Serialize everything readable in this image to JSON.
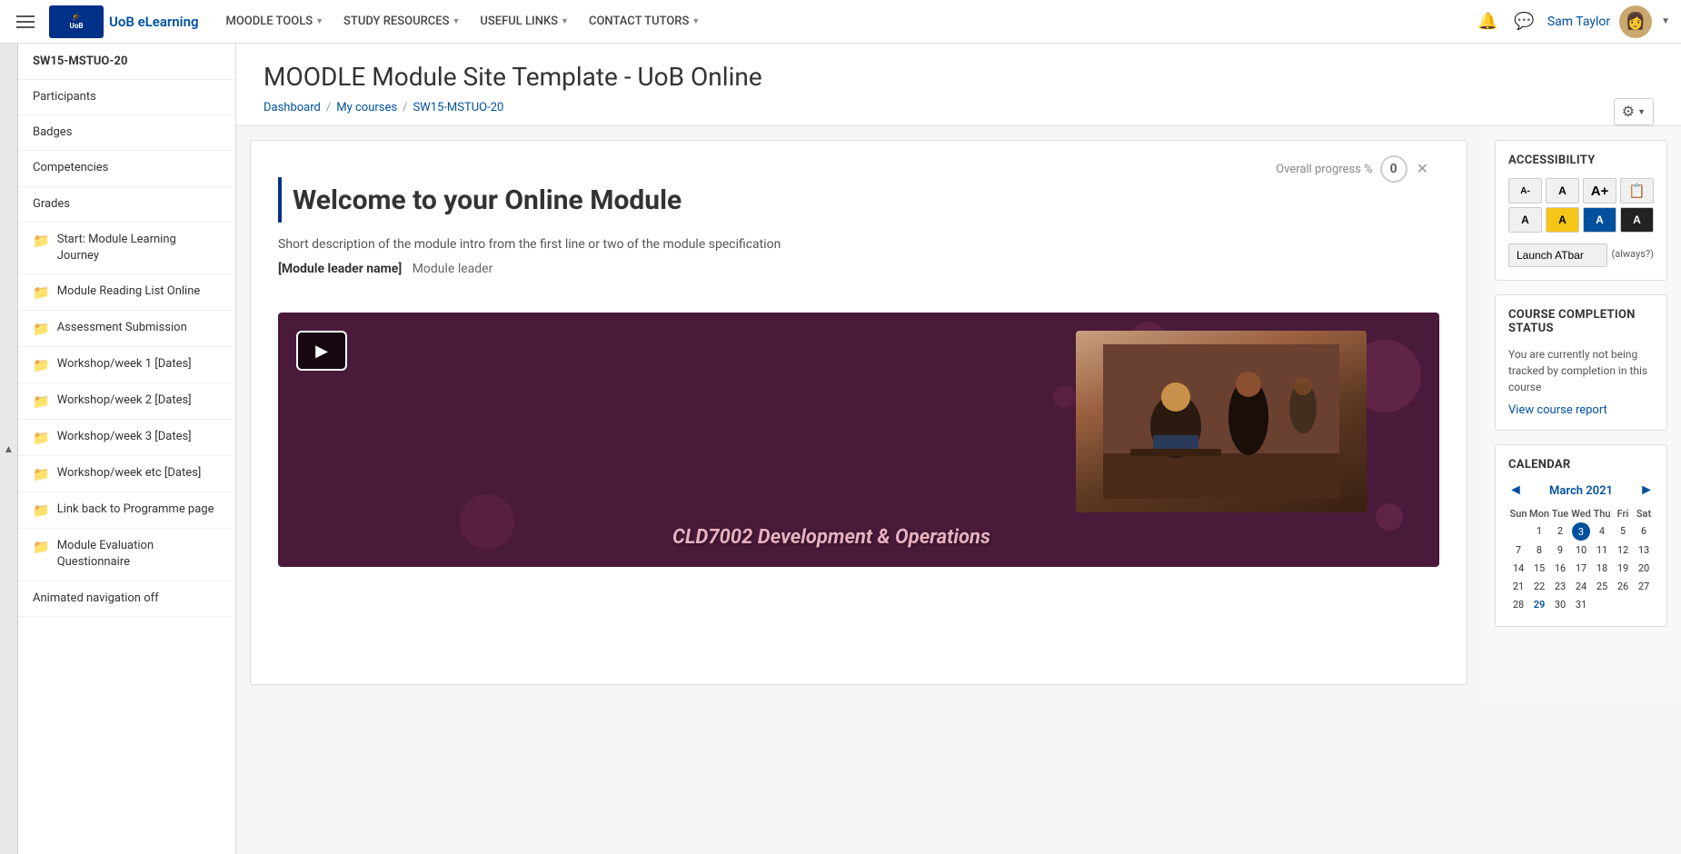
{
  "nav": {
    "hamburger_label": "Menu",
    "logo_text": "University\nof Bolton",
    "site_name": "UoB eLearning",
    "menu_items": [
      {
        "label": "MOODLE TOOLS",
        "has_dropdown": true
      },
      {
        "label": "STUDY RESOURCES",
        "has_dropdown": true
      },
      {
        "label": "USEFUL LINKS",
        "has_dropdown": true
      },
      {
        "label": "CONTACT TUTORS",
        "has_dropdown": true
      }
    ],
    "user_name": "Sam Taylor",
    "notification_icon": "🔔",
    "message_icon": "💬",
    "user_caret": "▼"
  },
  "sidebar": {
    "course_code": "SW15-MSTUO-20",
    "items": [
      {
        "label": "Participants",
        "has_icon": false
      },
      {
        "label": "Badges",
        "has_icon": false
      },
      {
        "label": "Competencies",
        "has_icon": false
      },
      {
        "label": "Grades",
        "has_icon": false
      },
      {
        "label": "Start: Module Learning Journey",
        "has_icon": true
      },
      {
        "label": "Module Reading List Online",
        "has_icon": true
      },
      {
        "label": "Assessment Submission",
        "has_icon": true
      },
      {
        "label": "Workshop/week 1 [Dates]",
        "has_icon": true
      },
      {
        "label": "Workshop/week 2 [Dates]",
        "has_icon": true
      },
      {
        "label": "Workshop/week 3 [Dates]",
        "has_icon": true
      },
      {
        "label": "Workshop/week etc [Dates]",
        "has_icon": true
      },
      {
        "label": "Link back to Programme page",
        "has_icon": true
      },
      {
        "label": "Module Evaluation Questionnaire",
        "has_icon": true
      },
      {
        "label": "Animated navigation off",
        "has_icon": false
      }
    ]
  },
  "page": {
    "title": "MOODLE Module Site Template - UoB Online",
    "breadcrumb": {
      "dashboard": "Dashboard",
      "sep1": "/",
      "my_courses": "My courses",
      "sep2": "/",
      "current": "SW15-MSTUO-20"
    },
    "settings_icon": "⚙",
    "progress_label": "Overall progress %",
    "progress_value": "0",
    "close_icon": "✕"
  },
  "welcome": {
    "heading": "Welcome to your Online Module",
    "description": "Short description of the module intro from the first line or two of the module specification",
    "module_leader_name": "[Module leader name]",
    "module_leader_role": "Module leader"
  },
  "video": {
    "course_label": "CLD7002 Development & Operations"
  },
  "accessibility": {
    "title": "ACCESSIBILITY",
    "buttons": [
      {
        "label": "A-",
        "style": "default",
        "size": "small"
      },
      {
        "label": "A",
        "style": "default",
        "size": "normal"
      },
      {
        "label": "A+",
        "style": "default",
        "size": "large"
      },
      {
        "label": "📋",
        "style": "default",
        "size": "normal"
      },
      {
        "label": "A",
        "style": "default",
        "size": "normal"
      },
      {
        "label": "A",
        "style": "yellow",
        "size": "normal"
      },
      {
        "label": "A",
        "style": "blue",
        "size": "normal"
      },
      {
        "label": "A",
        "style": "black",
        "size": "normal"
      }
    ],
    "launch_btn": "Launch ATbar",
    "always_label": "(always?)"
  },
  "completion": {
    "title": "COURSE COMPLETION STATUS",
    "text": "You are currently not being tracked by completion in this course",
    "view_report": "View course report"
  },
  "calendar": {
    "title": "CALENDAR",
    "month": "March 2021",
    "prev_icon": "◄",
    "next_icon": "►",
    "day_headers": [
      "Sun",
      "Mon",
      "Tue",
      "Wed",
      "Thu",
      "Fri",
      "Sat"
    ],
    "weeks": [
      [
        "",
        "1",
        "2",
        "3",
        "4",
        "5",
        "6"
      ],
      [
        "7",
        "8",
        "9",
        "10",
        "11",
        "12",
        "13"
      ],
      [
        "14",
        "15",
        "16",
        "17",
        "18",
        "19",
        "20"
      ],
      [
        "21",
        "22",
        "23",
        "24",
        "25",
        "26",
        "27"
      ],
      [
        "28",
        "29",
        "30",
        "31",
        "",
        "",
        ""
      ]
    ],
    "today": "3",
    "highlight_days": [
      "29"
    ]
  }
}
